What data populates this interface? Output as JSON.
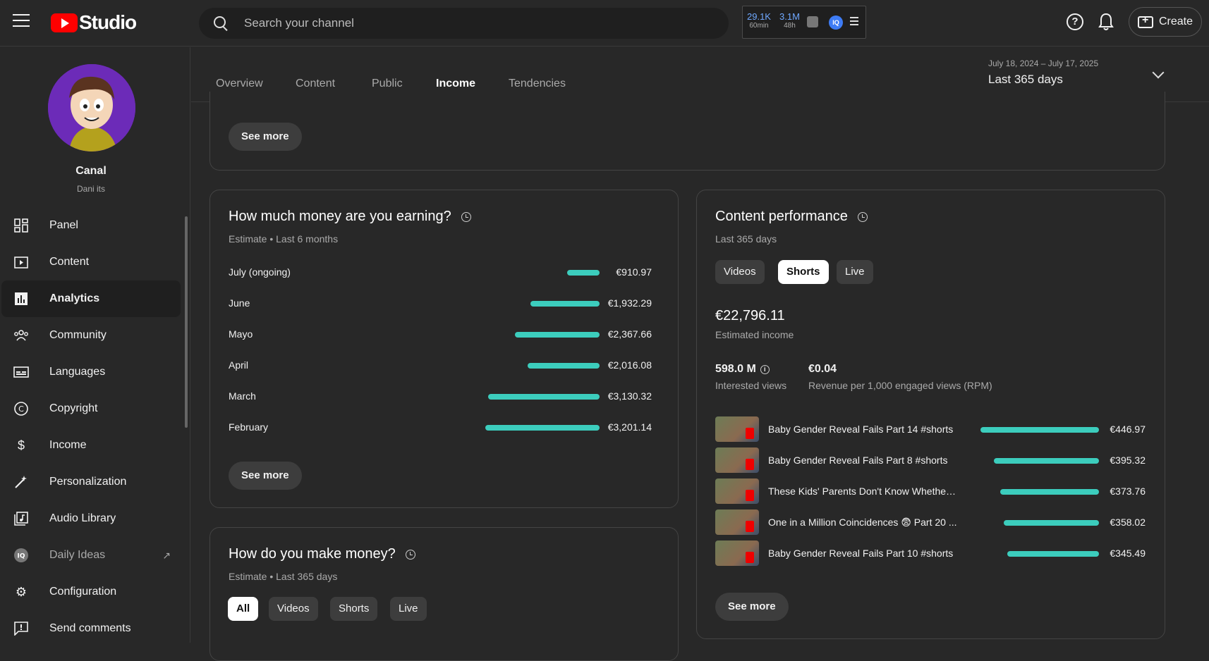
{
  "header": {
    "logo_text": "Studio",
    "search_placeholder": "Search your channel",
    "stats": [
      {
        "value": "29.1K",
        "label": "60min"
      },
      {
        "value": "3.1M",
        "label": "48h"
      }
    ],
    "iq_label": "IQ",
    "help": "?",
    "create_label": "Create"
  },
  "sidebar": {
    "channel_name": "Canal",
    "channel_handle": "Dani its",
    "items": [
      {
        "label": "Panel",
        "icon": "dashboard-icon"
      },
      {
        "label": "Content",
        "icon": "content-icon"
      },
      {
        "label": "Analytics",
        "icon": "analytics-icon",
        "active": true
      },
      {
        "label": "Community",
        "icon": "community-icon"
      },
      {
        "label": "Languages",
        "icon": "subtitles-icon"
      },
      {
        "label": "Copyright",
        "icon": "copyright-icon"
      },
      {
        "label": "Income",
        "icon": "dollar-icon"
      },
      {
        "label": "Personalization",
        "icon": "magic-wand-icon"
      },
      {
        "label": "Audio Library",
        "icon": "audio-library-icon"
      },
      {
        "label": "Daily Ideas",
        "icon": "iq-icon"
      },
      {
        "label": "Configuration",
        "icon": "gear-icon"
      },
      {
        "label": "Send comments",
        "icon": "feedback-icon"
      }
    ]
  },
  "tabs": {
    "items": [
      "Overview",
      "Content",
      "Public",
      "Income",
      "Tendencies"
    ],
    "active": "Income"
  },
  "date_range": {
    "dates": "July 18, 2024 – July 17, 2025",
    "label": "Last 365 days"
  },
  "top_card": {
    "see_more": "See more"
  },
  "earnings_card": {
    "title": "How much money are you earning?",
    "subtitle": "Estimate • Last 6 months",
    "see_more": "See more",
    "months": [
      {
        "label": "July (ongoing)",
        "value": "€910.97",
        "amount": 910.97
      },
      {
        "label": "June",
        "value": "€1,932.29",
        "amount": 1932.29
      },
      {
        "label": "Mayo",
        "value": "€2,367.66",
        "amount": 2367.66
      },
      {
        "label": "April",
        "value": "€2,016.08",
        "amount": 2016.08
      },
      {
        "label": "March",
        "value": "€3,130.32",
        "amount": 3130.32
      },
      {
        "label": "February",
        "value": "€3,201.14",
        "amount": 3201.14
      }
    ]
  },
  "make_money_card": {
    "title": "How do you make money?",
    "subtitle": "Estimate • Last 365 days",
    "chips": [
      "All",
      "Videos",
      "Shorts",
      "Live"
    ],
    "selected": "All"
  },
  "performance_card": {
    "title": "Content performance",
    "subtitle": "Last 365 days",
    "chips": [
      "Videos",
      "Shorts",
      "Live"
    ],
    "selected": "Shorts",
    "income_value": "€22,796.11",
    "income_label": "Estimated income",
    "views_value": "598.0 M",
    "views_label": "Interested views",
    "rpm_value": "€0.04",
    "rpm_label": "Revenue per 1,000 engaged views (RPM)",
    "see_more": "See more",
    "videos": [
      {
        "title": "Baby Gender Reveal Fails Part 14 #shorts",
        "value": "€446.97",
        "amount": 446.97
      },
      {
        "title": "Baby Gender Reveal Fails Part 8 #shorts",
        "value": "€395.32",
        "amount": 395.32
      },
      {
        "title": "These Kids' Parents Don't Know Whether t...",
        "value": "€373.76",
        "amount": 373.76
      },
      {
        "title": "One in a Million Coincidences 😨 Part 20 ...",
        "value": "€358.02",
        "amount": 358.02
      },
      {
        "title": "Baby Gender Reveal Fails Part 10 #shorts",
        "value": "€345.49",
        "amount": 345.49
      }
    ]
  },
  "colors": {
    "accent_bar": "#3ccdbd",
    "brand_red": "#ff0000",
    "background": "#282828"
  }
}
